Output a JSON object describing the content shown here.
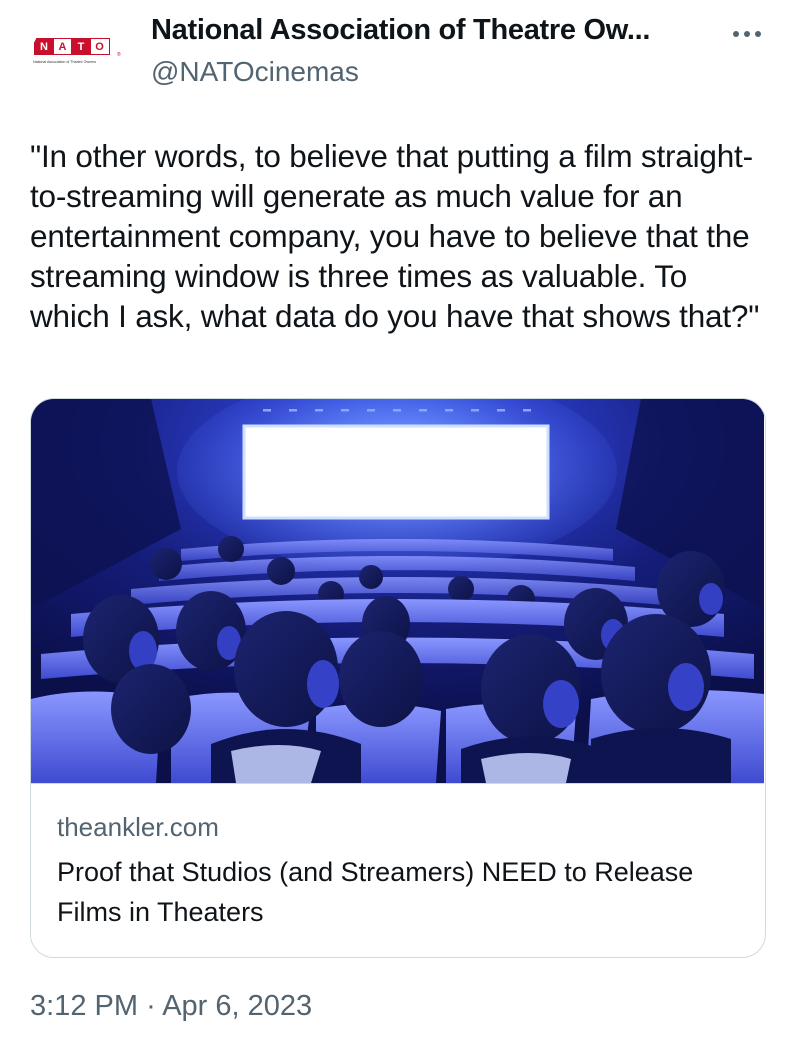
{
  "author": {
    "display_name": "National Association of Theatre Ow...",
    "handle": "@NATOcinemas",
    "avatar": {
      "logo_letters": [
        "N",
        "A",
        "T",
        "O"
      ],
      "registered_mark": "®",
      "tagline": "National Association of Theatre Owners"
    }
  },
  "tweet": {
    "text": "\"In other words, to believe that putting a film straight-to-streaming will generate as much value for an entertainment company, you have to believe that the streaming window is three times as valuable. To which I ask, what data do you have that shows that?\"",
    "time": "3:12 PM",
    "separator": "·",
    "date": "Apr 6, 2023"
  },
  "link_card": {
    "domain": "theankler.com",
    "title": "Proof that Studios (and Streamers) NEED to Release Films in Theaters",
    "image": "movie-theater-audience-illustration"
  },
  "icons": {
    "more": "more-options-icon"
  },
  "colors": {
    "text_primary": "#0f1419",
    "text_secondary": "#536471",
    "border": "#cfd9de",
    "logo_red": "#c8102e",
    "theater_dark": "#0b0f4a",
    "theater_blue": "#3b47d6",
    "screen_glow": "#e8f0ff"
  }
}
